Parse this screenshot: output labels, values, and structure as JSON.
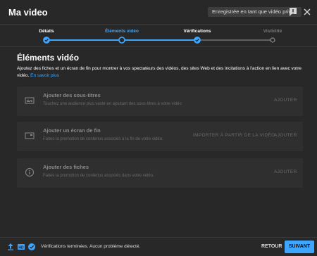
{
  "header": {
    "title": "Ma video",
    "save_chip": "Enregistrée en tant que vidéo privée"
  },
  "stepper": {
    "steps": [
      {
        "label": "Détails",
        "state": "done"
      },
      {
        "label": "Éléments vidéo",
        "state": "current"
      },
      {
        "label": "Vérifications",
        "state": "done"
      },
      {
        "label": "Visibilité",
        "state": "pending"
      }
    ]
  },
  "main": {
    "title": "Éléments vidéo",
    "description": "Ajoutez des fiches et un écran de fin pour montrer à vos spectateurs des vidéos, des sites Web et des incitations à l'action en lien avec votre vidéo. ",
    "more_link": "En savoir plus",
    "cards": [
      {
        "icon": "subtitles-icon",
        "title": "Ajouter des sous-titres",
        "description": "Touchez une audience plus vaste en ajoutant des sous-titres à votre vidéo",
        "buttons": [
          "AJOUTER"
        ]
      },
      {
        "icon": "end-screen-icon",
        "title": "Ajouter un écran de fin",
        "description": "Faites la promotion de contenus associés à la fin de votre vidéo.",
        "buttons": [
          "IMPORTER À PARTIR DE LA VIDÉO",
          "AJOUTER"
        ]
      },
      {
        "icon": "info-cards-icon",
        "title": "Ajouter des fiches",
        "description": "Faites la promotion de contenus associés dans votre vidéo.",
        "buttons": [
          "AJOUTER"
        ]
      }
    ]
  },
  "footer": {
    "status": "Vérifications terminées. Aucun problème détecté.",
    "back_label": "RETOUR",
    "next_label": "SUIVANT"
  },
  "colors": {
    "accent": "#3ea6ff",
    "background": "#282828",
    "card": "#2f2f2f"
  }
}
